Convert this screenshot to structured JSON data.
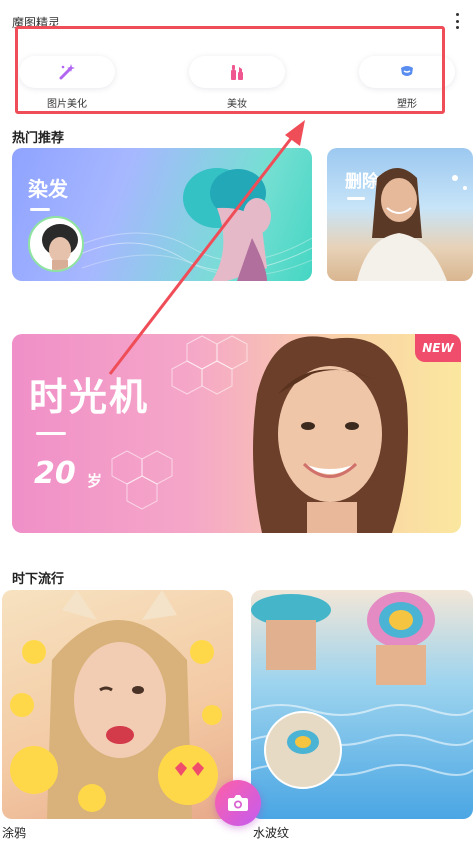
{
  "header": {
    "title": "魔图精灵",
    "more_icon": "more-vertical-icon"
  },
  "tools": [
    {
      "label": "图片美化",
      "icon": "magic-wand-icon",
      "color": "#b166f0"
    },
    {
      "label": "美妆",
      "icon": "makeup-icon",
      "color": "#f0568f"
    },
    {
      "label": "塑形",
      "icon": "body-shape-icon",
      "color": "#5a8df0"
    }
  ],
  "recommend": {
    "title": "热门推荐",
    "cards": [
      {
        "label": "染发"
      },
      {
        "label": "删除杂物"
      }
    ],
    "banner": {
      "title": "时光机",
      "age": "20",
      "age_unit": "岁",
      "badge": "NEW"
    }
  },
  "trending": {
    "title": "时下流行",
    "cards": [
      {
        "label": "涂鸦"
      },
      {
        "label": "水波纹"
      }
    ]
  },
  "camera": {
    "icon": "camera-icon"
  },
  "colors": {
    "highlight": "#ef4d57",
    "accent_pink": "#ef4d6b",
    "fab_start": "#ff5fa6",
    "fab_end": "#c35cf1"
  }
}
